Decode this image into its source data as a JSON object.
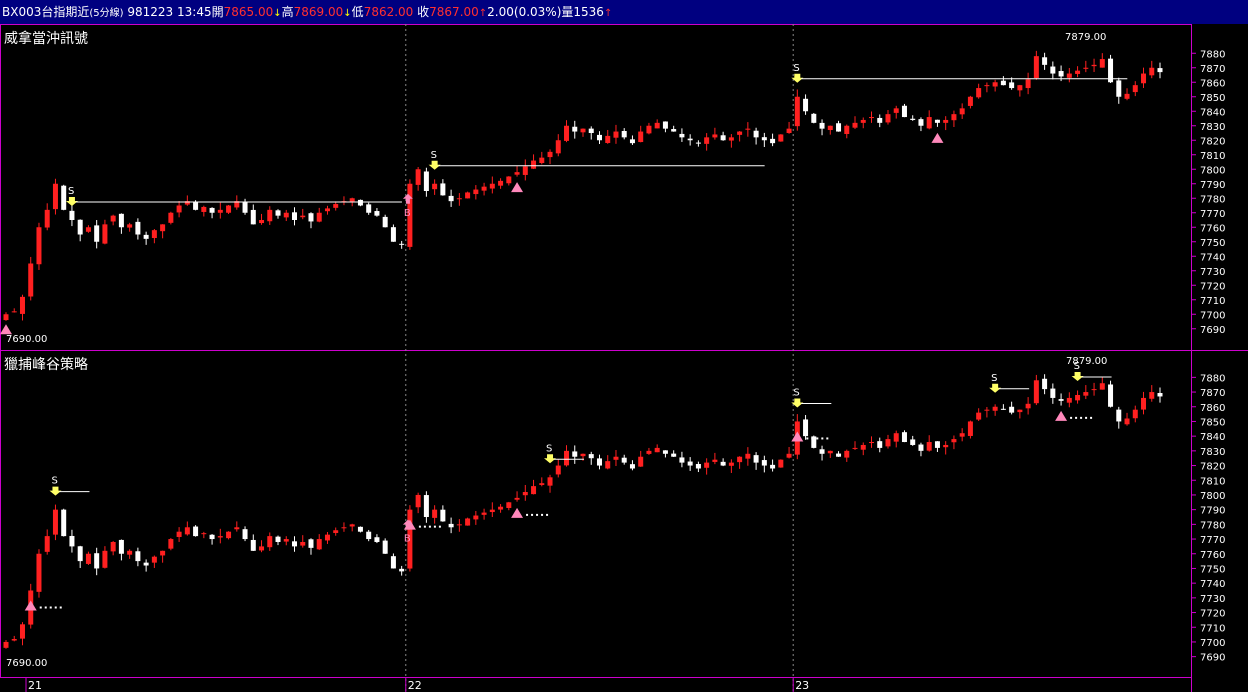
{
  "header": {
    "symbol": "BX003",
    "name": "台指期近",
    "interval": "(5分線)",
    "date": "981223",
    "time": "13:45",
    "open_label": "開",
    "open": "7865.00",
    "high_label": "高",
    "high": "7869.00",
    "low_label": "低",
    "low": "7862.00",
    "close_label": "收",
    "close": "7867.00",
    "change": "2.00",
    "change_pct": "(0.03%)",
    "volume_label": "量",
    "volume": "1536"
  },
  "colors": {
    "title_bg": "#000080",
    "bg": "#000000",
    "up": "#ff2020",
    "down": "#ffffff",
    "frame": "#cc00cc",
    "buy_marker": "#ff88bb",
    "sell_marker": "#ffff66"
  },
  "panes": [
    {
      "title": "威拿當沖訊號",
      "max_label": "7879.00",
      "min_label": "7690.00"
    },
    {
      "title": "獵捕峰谷策略",
      "max_label": "7879.00",
      "min_label": "7690.00"
    }
  ],
  "y_axis_ticks": [
    "7880",
    "7870",
    "7860",
    "7850",
    "7840",
    "7830",
    "7820",
    "7810",
    "7800",
    "7790",
    "7780",
    "7770",
    "7760",
    "7750",
    "7740",
    "7730",
    "7720",
    "7710",
    "7700",
    "7690"
  ],
  "x_axis_labels": [
    "21",
    "22",
    "23"
  ],
  "signal_labels": {
    "sell": "S",
    "buy": "B"
  },
  "chart_data": {
    "type": "candlestick",
    "ylim": [
      7685,
      7885
    ],
    "days": [
      "21",
      "22",
      "23"
    ],
    "closes": [
      7700,
      7702,
      7712,
      7735,
      7760,
      7772,
      7790,
      7772,
      7765,
      7755,
      7760,
      7750,
      7762,
      7768,
      7760,
      7762,
      7755,
      7752,
      7758,
      7762,
      7770,
      7775,
      7778,
      7772,
      7774,
      7770,
      7772,
      7775,
      7778,
      7770,
      7762,
      7765,
      7772,
      7768,
      7770,
      7765,
      7768,
      7764,
      7770,
      7773,
      7776,
      7778,
      7780,
      7775,
      7770,
      7768,
      7760,
      7750,
      7748,
      7790,
      7800,
      7785,
      7790,
      7782,
      7778,
      7780,
      7784,
      7786,
      7788,
      7790,
      7792,
      7795,
      7798,
      7802,
      7806,
      7808,
      7812,
      7820,
      7830,
      7826,
      7828,
      7825,
      7820,
      7823,
      7826,
      7822,
      7818,
      7826,
      7830,
      7832,
      7828,
      7826,
      7822,
      7820,
      7818,
      7822,
      7824,
      7820,
      7822,
      7826,
      7828,
      7822,
      7820,
      7818,
      7824,
      7828,
      7850,
      7840,
      7832,
      7828,
      7830,
      7826,
      7830,
      7832,
      7834,
      7836,
      7832,
      7838,
      7842,
      7836,
      7834,
      7830,
      7836,
      7832,
      7834,
      7838,
      7842,
      7850,
      7856,
      7858,
      7860,
      7858,
      7856,
      7858,
      7862,
      7878,
      7872,
      7866,
      7864,
      7866,
      7868,
      7870,
      7872,
      7876,
      7860,
      7850,
      7852,
      7858,
      7866,
      7870,
      7867
    ],
    "day_close": [
      7748,
      7828,
      7867
    ],
    "visible_high": 7879.0,
    "visible_low": 7690.0
  }
}
